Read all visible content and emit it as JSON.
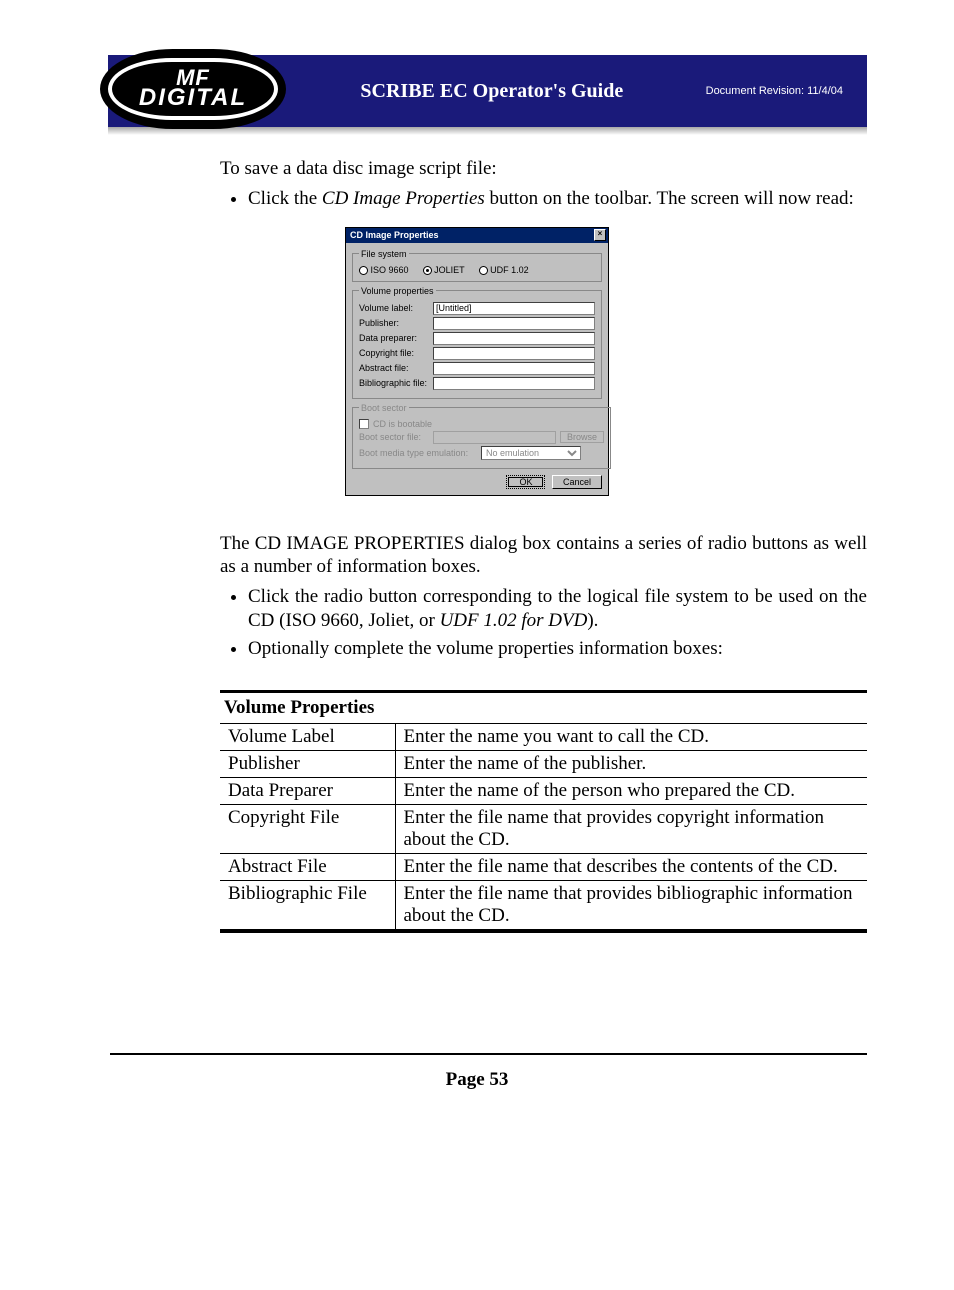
{
  "header": {
    "logo_line1": "MF",
    "logo_line2": "DIGITAL",
    "title": "SCRIBE EC Operator's Guide",
    "revision": "Document Revision: 11/4/04"
  },
  "intro": {
    "lead": "To save a data disc image script file:",
    "bullet1_prefix": "Click the ",
    "bullet1_italic": "CD Image Properties",
    "bullet1_suffix": " button on the toolbar. The screen will now read:"
  },
  "dialog": {
    "title": "CD Image Properties",
    "close_glyph": "×",
    "fs_legend": "File system",
    "fs_options": {
      "iso": "ISO 9660",
      "joliet": "JOLIET",
      "udf": "UDF 1.02"
    },
    "vp_legend": "Volume properties",
    "vp_labels": {
      "volume": "Volume label:",
      "publisher": "Publisher:",
      "preparer": "Data preparer:",
      "copyright": "Copyright file:",
      "abstract": "Abstract file:",
      "biblio": "Bibliographic file:"
    },
    "volume_value": "[Untitled]",
    "boot_legend": "Boot sector",
    "boot_check_label": "CD is bootable",
    "boot_file_label": "Boot sector file:",
    "boot_emul_label": "Boot media type emulation:",
    "boot_emul_value": "No emulation",
    "browse_label": "Browse",
    "ok_label": "OK",
    "cancel_label": "Cancel"
  },
  "after_dialog": {
    "para": "The CD IMAGE PROPERTIES dialog box contains a series of radio buttons as well as a number of information boxes.",
    "b1_a": "Click the radio button corresponding to the logical file system to be used on the CD  (ISO 9660, Joliet, or ",
    "b1_i": "UDF 1.02 for DVD",
    "b1_b": ").",
    "b2": "Optionally complete the volume properties information boxes:"
  },
  "table": {
    "title": "Volume Properties",
    "rows": [
      {
        "k": "Volume Label",
        "v": "Enter the name you want to call the CD."
      },
      {
        "k": "Publisher",
        "v": "Enter the name of the publisher."
      },
      {
        "k": "Data Preparer",
        "v": "Enter the name of the person who prepared the CD."
      },
      {
        "k": "Copyright File",
        "v": "Enter the file name that provides copyright information about the CD."
      },
      {
        "k": "Abstract File",
        "v": "Enter the file name that describes the contents of the CD."
      },
      {
        "k": "Bibliographic File",
        "v": "Enter the file name that provides bibliographic information about the CD."
      }
    ]
  },
  "footer": {
    "page": "Page 53"
  }
}
